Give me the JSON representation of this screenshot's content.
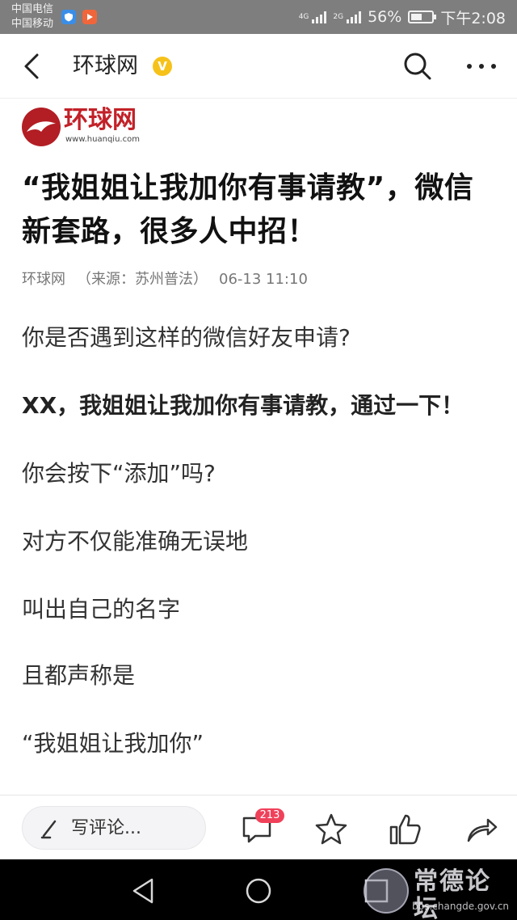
{
  "status_bar": {
    "carrier_1": "中国电信",
    "carrier_2": "中国移动",
    "net_1": "4G",
    "net_2": "2G",
    "battery": "56%",
    "battery_level": 0.56,
    "time": "下午2:08"
  },
  "header": {
    "title": "环球网",
    "verified_mark": "V",
    "accent_color": "#f6c21a"
  },
  "logo": {
    "name": "环球网",
    "url": "www.huanqiu.com",
    "brand_color": "#c22128"
  },
  "article": {
    "title": "“我姐姐让我加你有事请教”，微信新套路，很多人中招！",
    "meta": {
      "source": "环球网",
      "origin": "（来源：苏州普法）",
      "time": "06-13 11:10"
    },
    "paragraphs": [
      "你是否遇到这样的微信好友申请?",
      "XX，我姐姐让我加你有事请教，通过一下！",
      "你会按下“添加”吗?",
      "对方不仅能准确无误地",
      "叫出自己的名字",
      "且都声称是",
      "“我姐姐让我加你”"
    ]
  },
  "action_bar": {
    "comment_placeholder": "写评论...",
    "comment_count": "213",
    "badge_color": "#f0415a"
  },
  "icons": [
    "back-icon",
    "search-icon",
    "more-icon",
    "pencil-icon",
    "comment-icon",
    "star-icon",
    "thumbs-up-icon",
    "share-icon",
    "nav-back-icon",
    "nav-home-icon",
    "nav-recents-icon"
  ],
  "watermark": {
    "text": "常德论坛",
    "url": "bbs.changde.gov.cn"
  }
}
